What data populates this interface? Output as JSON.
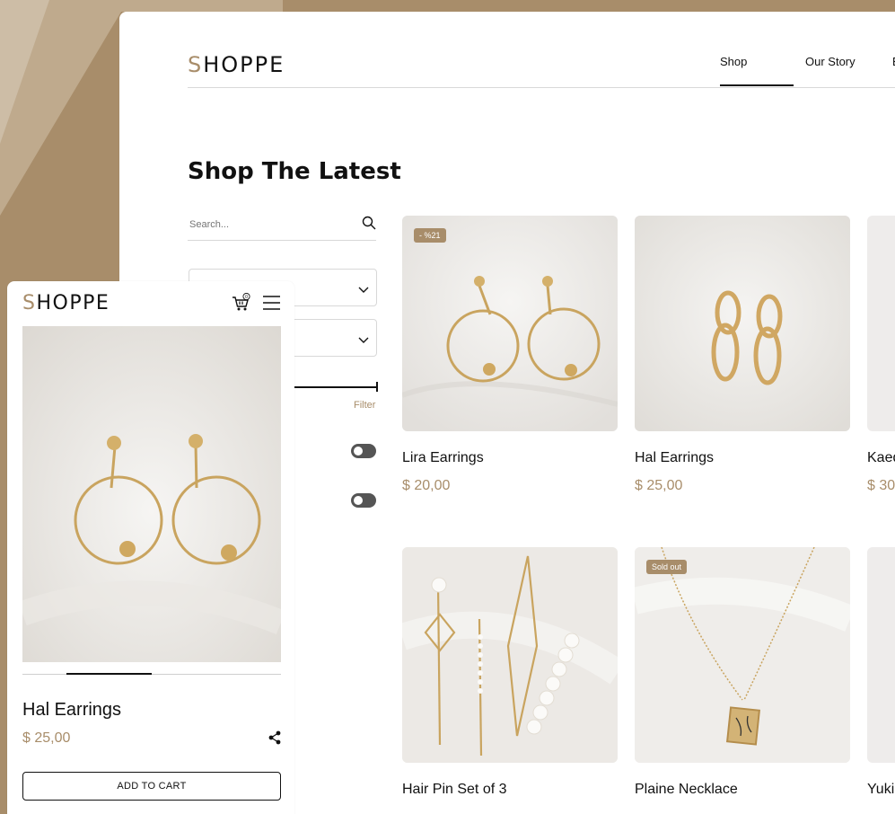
{
  "brand": {
    "logo_first": "S",
    "logo_rest": "HOPPE",
    "accent": "#a88d6a"
  },
  "desktop": {
    "nav": [
      {
        "label": "Shop",
        "active": true
      },
      {
        "label": "Our Story",
        "active": false
      },
      {
        "label": "B",
        "active": false
      }
    ],
    "title": "Shop The Latest",
    "search_placeholder": "Search...",
    "filter_label": "Filter",
    "products": [
      {
        "name": "Lira Earrings",
        "price": "$ 20,00",
        "badge": "- %21"
      },
      {
        "name": "Hal Earrings",
        "price": "$ 25,00",
        "badge": ""
      },
      {
        "name": "Kaed",
        "price": "$ 30",
        "badge": ""
      },
      {
        "name": "Hair Pin Set of 3",
        "price": "",
        "badge": ""
      },
      {
        "name": "Plaine Necklace",
        "price": "",
        "badge": "Sold out"
      },
      {
        "name": "Yuki",
        "price": "",
        "badge": ""
      }
    ]
  },
  "mobile": {
    "cart_count": "0",
    "product_name": "Hal Earrings",
    "price": "$ 25,00",
    "add_to_cart": "ADD TO CART",
    "gallery_progress": 0.33
  }
}
